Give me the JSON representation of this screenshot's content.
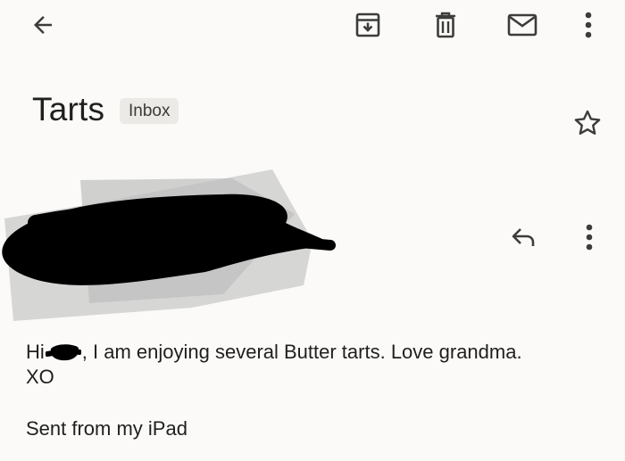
{
  "toolbar": {
    "icons": [
      "back-arrow-icon",
      "archive-icon",
      "delete-icon",
      "mark-unread-icon",
      "more-vert-icon"
    ]
  },
  "email": {
    "subject": "Tarts",
    "label": "Inbox",
    "body_greeting": "Hi",
    "body_rest": ", I am enjoying several Butter tarts. Love grandma.",
    "body_line2": "XO",
    "signature": "Sent from my iPad"
  },
  "sender": {
    "redacted": true
  },
  "colors": {
    "background": "#fbfaf8",
    "text": "#1f1f1f",
    "chip": "#eceae6",
    "icon": "#3c3c3c",
    "redaction": "#000000",
    "redaction_grey": "#cfcfcf"
  }
}
